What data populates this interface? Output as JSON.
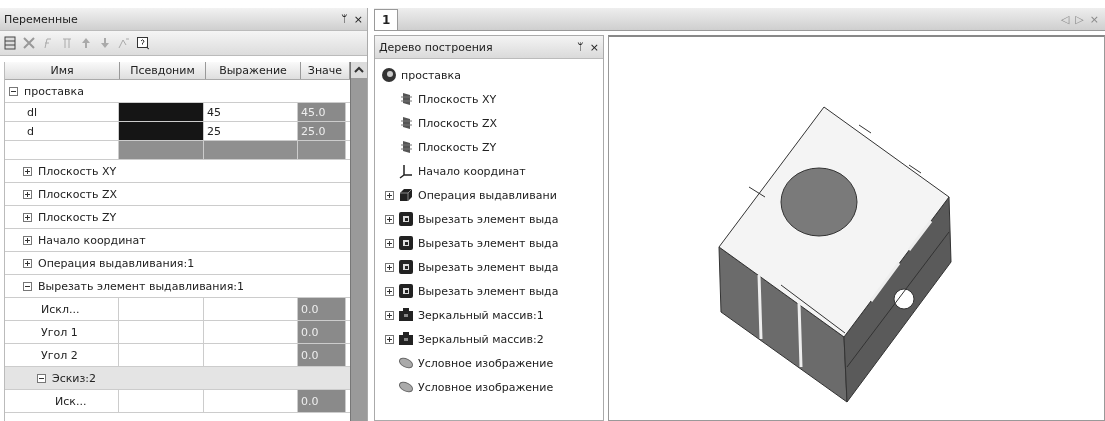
{
  "variables": {
    "title": "Переменные",
    "pin": "ᛘ",
    "close": "×",
    "columns": [
      "Имя",
      "Псевдоним",
      "Выражение",
      "Значе"
    ],
    "rows": [
      {
        "name": "проставка",
        "kind": "group",
        "expanded": true,
        "children": [
          {
            "name": "dl",
            "kind": "variable",
            "highlighted": true,
            "expression": "45",
            "value": "45.0"
          },
          {
            "name": "d",
            "kind": "variable",
            "highlighted": true,
            "expression": "25",
            "value": "25.0"
          },
          {
            "kind": "blank"
          },
          {
            "name": "Плоскость XY",
            "kind": "group",
            "expanded": false
          },
          {
            "name": "Плоскость ZX",
            "kind": "group",
            "expanded": false
          },
          {
            "name": "Плоскость ZY",
            "kind": "group",
            "expanded": false
          },
          {
            "name": "Начало координат",
            "kind": "group",
            "expanded": false
          },
          {
            "name": "Операция выдавливания:1",
            "kind": "group",
            "expanded": false
          },
          {
            "name": "Вырезать элемент выдавливания:1",
            "kind": "group",
            "expanded": true,
            "children": [
              {
                "name": "Искл...",
                "kind": "variable",
                "highlighted": false,
                "value": "0.0"
              },
              {
                "name": "Угол 1",
                "kind": "variable",
                "highlighted": false,
                "value": "0.0"
              },
              {
                "name": "Угол 2",
                "kind": "variable",
                "highlighted": false,
                "value": "0.0"
              },
              {
                "name": "Эскиз:2",
                "kind": "group",
                "expanded": true,
                "children": [
                  {
                    "name": "Иск...",
                    "kind": "variable",
                    "highlighted": false,
                    "value": "0.0"
                  }
                ]
              }
            ]
          }
        ]
      }
    ]
  },
  "document_tabs": {
    "tabs": [
      {
        "label": "1",
        "selected": true
      }
    ],
    "controls": [
      "◁",
      "▷",
      "×"
    ]
  },
  "build_tree": {
    "title": "Дерево построения",
    "pin": "ᛘ",
    "close": "×",
    "items": [
      {
        "label": "проставка",
        "kind": "part",
        "children": [
          {
            "label": "Плоскость XY",
            "kind": "plane"
          },
          {
            "label": "Плоскость ZX",
            "kind": "plane"
          },
          {
            "label": "Плоскость ZY",
            "kind": "plane"
          },
          {
            "label": "Начало координат",
            "kind": "origin"
          },
          {
            "label": "Операция выдавливани",
            "kind": "extrude",
            "expanded": false
          },
          {
            "label": "Вырезать элемент выда",
            "kind": "cut",
            "expanded": false
          },
          {
            "label": "Вырезать элемент выда",
            "kind": "cut",
            "expanded": false
          },
          {
            "label": "Вырезать элемент выда",
            "kind": "cut",
            "expanded": false
          },
          {
            "label": "Вырезать элемент выда",
            "kind": "cut",
            "expanded": false
          },
          {
            "label": "Зеркальный массив:1",
            "kind": "mirror",
            "expanded": false
          },
          {
            "label": "Зеркальный массив:2",
            "kind": "mirror",
            "expanded": false
          },
          {
            "label": "Условное изображение",
            "kind": "thread"
          },
          {
            "label": "Условное изображение",
            "kind": "thread"
          }
        ]
      }
    ]
  }
}
